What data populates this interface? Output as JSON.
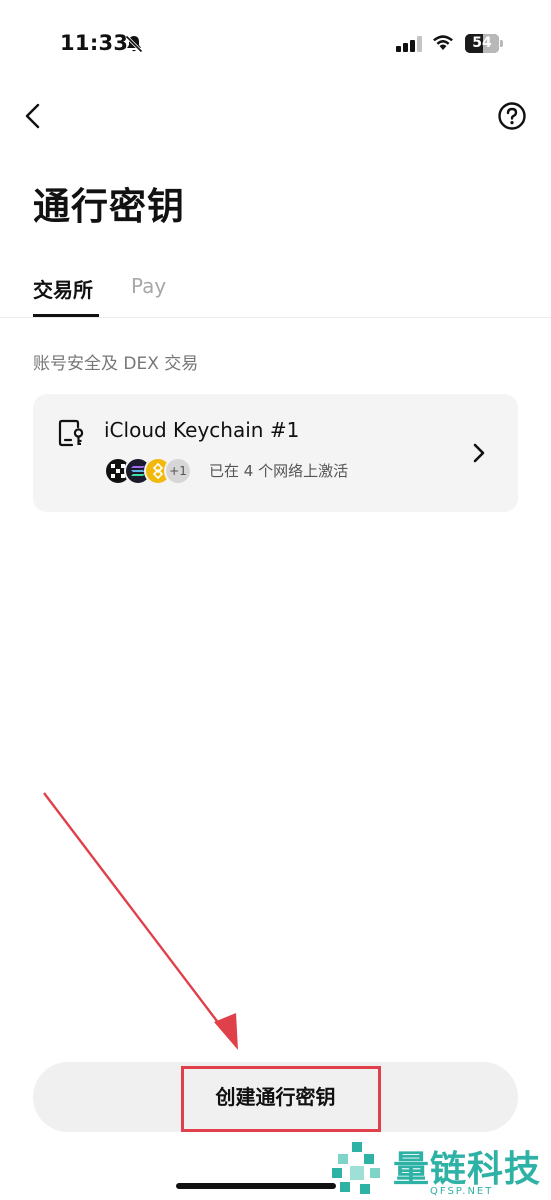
{
  "status_bar": {
    "time": "11:33",
    "battery_level": "54",
    "battery_percent": 54
  },
  "header": {
    "title": "通行密钥"
  },
  "tabs": [
    {
      "label": "交易所",
      "active": true
    },
    {
      "label": "Pay",
      "active": false
    }
  ],
  "section": {
    "label": "账号安全及 DEX 交易"
  },
  "passkey": {
    "name": "iCloud Keychain #1",
    "networks": [
      "okx-icon",
      "solana-icon",
      "bnb-icon"
    ],
    "more_networks": "+1",
    "status": "已在 4 个网络上激活"
  },
  "actions": {
    "create_label": "创建通行密钥"
  },
  "watermark": {
    "brand": "量链科技",
    "site": "QFSP.NET"
  },
  "colors": {
    "accent_annotation": "#e0404a",
    "watermark": "#2fb2a6",
    "card_bg": "#f4f4f4"
  }
}
